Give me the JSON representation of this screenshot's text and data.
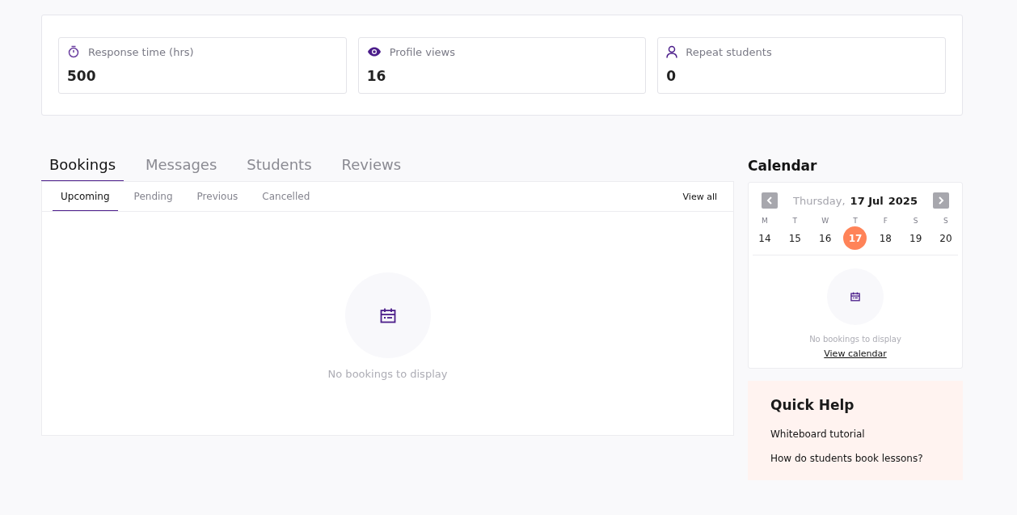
{
  "stats": [
    {
      "kind": "timer",
      "label": "Response time (hrs)",
      "value": "500"
    },
    {
      "kind": "views",
      "label": "Profile views",
      "value": "16"
    },
    {
      "kind": "students",
      "label": "Repeat students",
      "value": "0"
    }
  ],
  "tabs": [
    {
      "label": "Bookings",
      "selected": true
    },
    {
      "label": "Messages",
      "selected": false
    },
    {
      "label": "Students",
      "selected": false
    },
    {
      "label": "Reviews",
      "selected": false
    }
  ],
  "subtabs": [
    {
      "label": "Upcoming",
      "selected": true
    },
    {
      "label": "Pending",
      "selected": false
    },
    {
      "label": "Previous",
      "selected": false
    },
    {
      "label": "Cancelled",
      "selected": false
    }
  ],
  "view_all": "View all",
  "empty_text": "No bookings to display",
  "calendar": {
    "title": "Calendar",
    "weekday": "Thursday,",
    "date": "17 Jul",
    "year": "2025",
    "days": [
      {
        "letter": "M",
        "number": "14",
        "selected": false
      },
      {
        "letter": "T",
        "number": "15",
        "selected": false
      },
      {
        "letter": "W",
        "number": "16",
        "selected": false
      },
      {
        "letter": "T",
        "number": "17",
        "selected": true
      },
      {
        "letter": "F",
        "number": "18",
        "selected": false
      },
      {
        "letter": "S",
        "number": "19",
        "selected": false
      },
      {
        "letter": "S",
        "number": "20",
        "selected": false
      }
    ],
    "empty_text": "No bookings to display",
    "link": "View calendar"
  },
  "quick_help": {
    "title": "Quick Help",
    "links": [
      "Whiteboard tutorial",
      "How do students book lessons?"
    ]
  }
}
